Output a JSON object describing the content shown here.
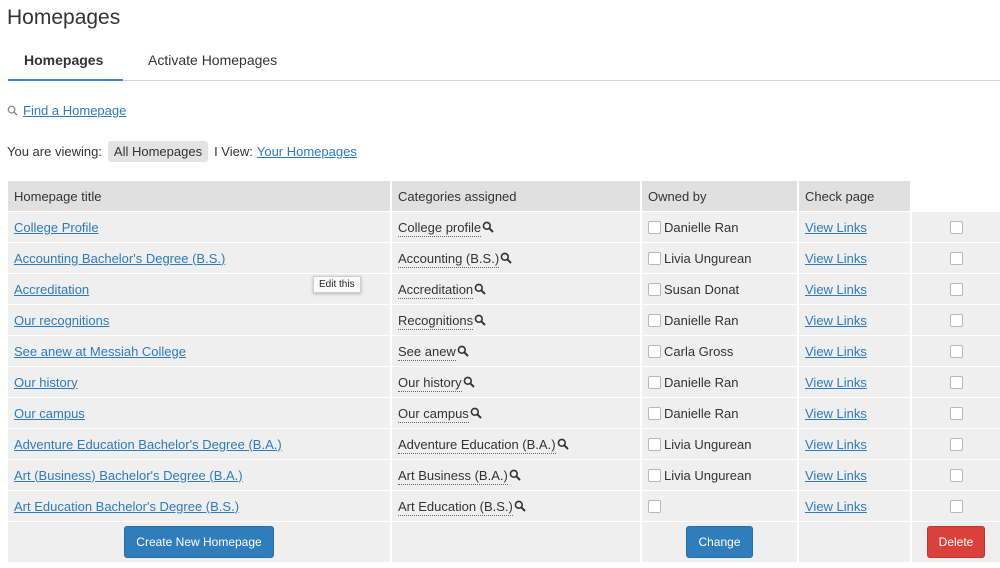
{
  "page": {
    "title": "Homepages"
  },
  "tabs": [
    {
      "label": "Homepages",
      "active": true
    },
    {
      "label": "Activate Homepages",
      "active": false
    }
  ],
  "find": {
    "label": "Find a Homepage",
    "icon": "search-icon"
  },
  "viewing": {
    "prefix": "You are viewing:",
    "current": "All Homepages",
    "separator": "I View:",
    "alt_link": "Your Homepages"
  },
  "table": {
    "headers": {
      "title": "Homepage title",
      "categories": "Categories assigned",
      "owner": "Owned by",
      "check": "Check page"
    },
    "rows": [
      {
        "title": "College Profile",
        "category": "College profile",
        "owner": "Danielle Ran",
        "check": "View Links"
      },
      {
        "title": "Accounting Bachelor's Degree (B.S.)",
        "category": "Accounting (B.S.)",
        "owner": "Livia Ungurean",
        "check": "View Links"
      },
      {
        "title": "Accreditation",
        "category": "Accreditation",
        "owner": "Susan Donat",
        "check": "View Links"
      },
      {
        "title": "Our recognitions",
        "category": "Recognitions",
        "owner": "Danielle Ran",
        "check": "View Links"
      },
      {
        "title": "See anew at Messiah College",
        "category": "See anew",
        "owner": "Carla Gross",
        "check": "View Links"
      },
      {
        "title": "Our history",
        "category": "Our history",
        "owner": "Danielle Ran",
        "check": "View Links"
      },
      {
        "title": "Our campus",
        "category": "Our campus",
        "owner": "Danielle Ran",
        "check": "View Links"
      },
      {
        "title": "Adventure Education Bachelor's Degree (B.A.)",
        "category": "Adventure Education (B.A.)",
        "owner": "Livia Ungurean",
        "check": "View Links"
      },
      {
        "title": "Art (Business) Bachelor's Degree (B.A.)",
        "category": "Art Business (B.A.)",
        "owner": "Livia Ungurean",
        "check": "View Links"
      },
      {
        "title": "Art Education Bachelor's Degree (B.S.)",
        "category": "Art Education (B.S.)",
        "owner": "",
        "check": "View Links"
      }
    ]
  },
  "tooltip": {
    "text": "Edit this"
  },
  "buttons": {
    "create": "Create New Homepage",
    "change": "Change",
    "delete": "Delete"
  },
  "colors": {
    "link": "#2e7bb8",
    "primary": "#2f7dbb",
    "danger": "#d9413a",
    "tab_underline": "#3a88c8"
  }
}
